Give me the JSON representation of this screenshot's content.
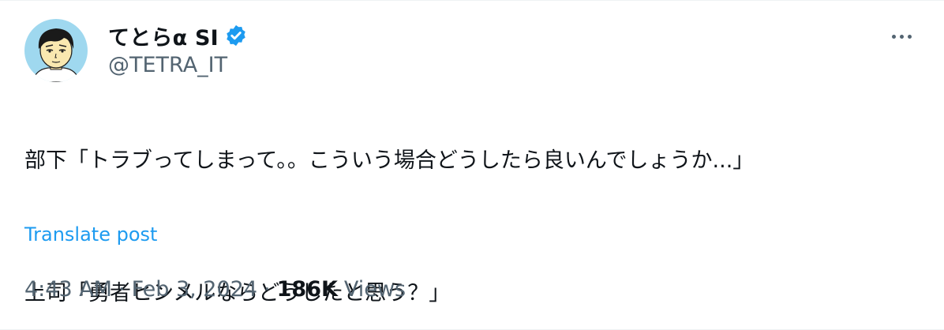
{
  "author": {
    "display_name": "てとらα SI",
    "handle": "@TETRA_IT",
    "verified": true,
    "avatar_icon": "cartoon-person-avatar"
  },
  "post": {
    "lines": [
      "部下「トラブってしまって。。こういう場合どうしたら良いんでしょうか...」",
      "上司「勇者ヒンメルならどうしたと思う？」"
    ],
    "translate_label": "Translate post"
  },
  "meta": {
    "time": "4:43 AM",
    "separator": "·",
    "date": "Feb 3, 2024",
    "views_count": "186K",
    "views_label": "Views"
  },
  "icons": {
    "more": "more-options-icon",
    "verified": "verified-badge-icon"
  },
  "colors": {
    "text_primary": "#0f1419",
    "text_secondary": "#536471",
    "accent_blue": "#1d9bf0"
  }
}
